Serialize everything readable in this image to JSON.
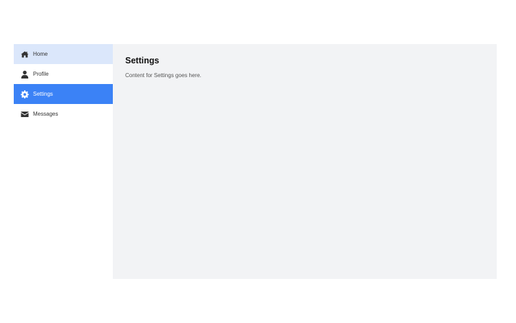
{
  "sidebar": {
    "items": [
      {
        "label": "Home",
        "icon": "home-icon"
      },
      {
        "label": "Profile",
        "icon": "user-icon"
      },
      {
        "label": "Settings",
        "icon": "gear-icon"
      },
      {
        "label": "Messages",
        "icon": "envelope-icon"
      }
    ],
    "active_item": "Settings",
    "hovered_item": "Home"
  },
  "main": {
    "title": "Settings",
    "body": "Content for Settings goes here."
  },
  "colors": {
    "accent": "#3b82f6",
    "hover": "#dbe7fb",
    "content_bg": "#f2f3f5"
  }
}
